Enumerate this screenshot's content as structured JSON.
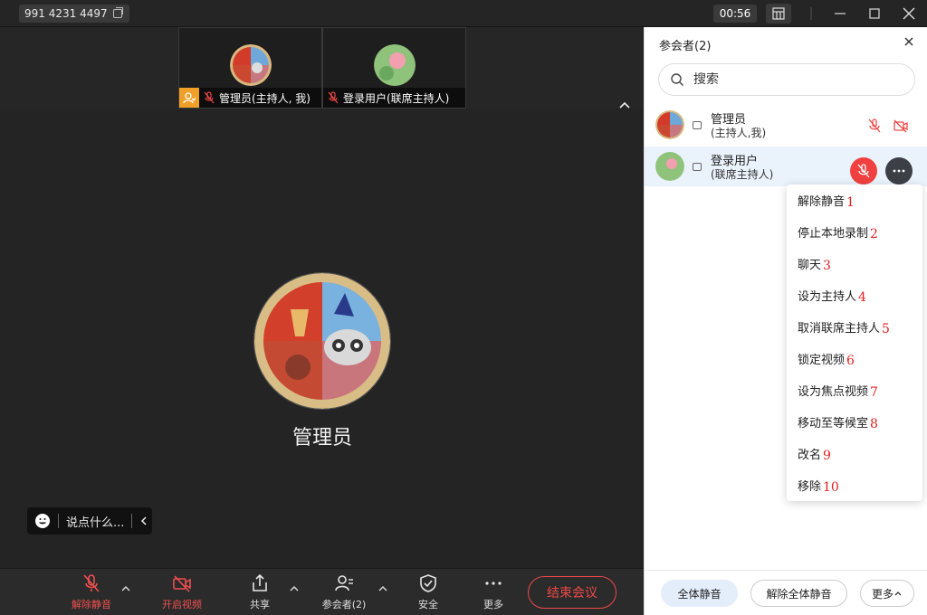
{
  "topbar": {
    "meeting_id": "991 4231 4497",
    "timer": "00:56"
  },
  "strip": {
    "tile1_name": "管理员(主持人, 我)",
    "tile2_name": "登录用户(联席主持人)"
  },
  "center": {
    "name": "管理员"
  },
  "chat": {
    "placeholder": "说点什么..."
  },
  "toolbar": {
    "unmute": "解除静音",
    "start_video": "开启视频",
    "share": "共享",
    "participants": "参会者(2)",
    "security": "安全",
    "more": "更多",
    "end": "结束会议"
  },
  "panel": {
    "title": "参会者(2)",
    "search_placeholder": "搜索",
    "participants": [
      {
        "name": "管理员",
        "role": "(主持人,我)"
      },
      {
        "name": "登录用户",
        "role": "(联席主持人)"
      }
    ],
    "menu": [
      {
        "label": "解除静音",
        "num": "1"
      },
      {
        "label": "停止本地录制",
        "num": "2"
      },
      {
        "label": "聊天",
        "num": "3"
      },
      {
        "label": "设为主持人",
        "num": "4"
      },
      {
        "label": "取消联席主持人",
        "num": "5"
      },
      {
        "label": "锁定视频",
        "num": "6"
      },
      {
        "label": "设为焦点视频",
        "num": "7"
      },
      {
        "label": "移动至等候室",
        "num": "8"
      },
      {
        "label": "改名",
        "num": "9"
      },
      {
        "label": "移除",
        "num": "10"
      }
    ],
    "footer": {
      "mute_all": "全体静音",
      "unmute_all": "解除全体静音",
      "more": "更多"
    }
  },
  "colors": {
    "accent_red": "#f04040",
    "host_badge": "#f0a028",
    "panel_selected": "#eaf2fb"
  }
}
